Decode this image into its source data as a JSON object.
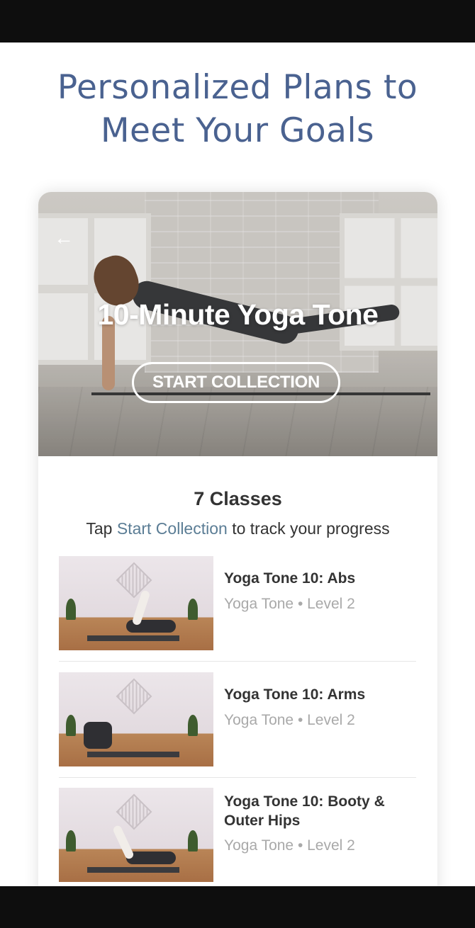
{
  "headline": {
    "line1": "Personalized Plans to",
    "line2": "Meet Your Goals"
  },
  "collection": {
    "title": "10-Minute Yoga Tone",
    "start_label": "START COLLECTION",
    "classes_count": "7 Classes",
    "hint_prefix": "Tap ",
    "hint_link": "Start Collection",
    "hint_suffix": " to track your progress"
  },
  "classes": [
    {
      "title": "Yoga Tone 10: Abs",
      "meta": "Yoga Tone • Level 2"
    },
    {
      "title": "Yoga Tone 10: Arms",
      "meta": "Yoga Tone • Level 2"
    },
    {
      "title": "Yoga Tone 10: Booty & Outer Hips",
      "meta": "Yoga Tone • Level 2"
    }
  ],
  "icons": {
    "back": "arrow-left-icon"
  },
  "colors": {
    "headline": "#4a6290",
    "link": "#5b7d95",
    "text": "#333333",
    "meta": "#a9a9a9",
    "system_bar": "#0e0e0e"
  }
}
